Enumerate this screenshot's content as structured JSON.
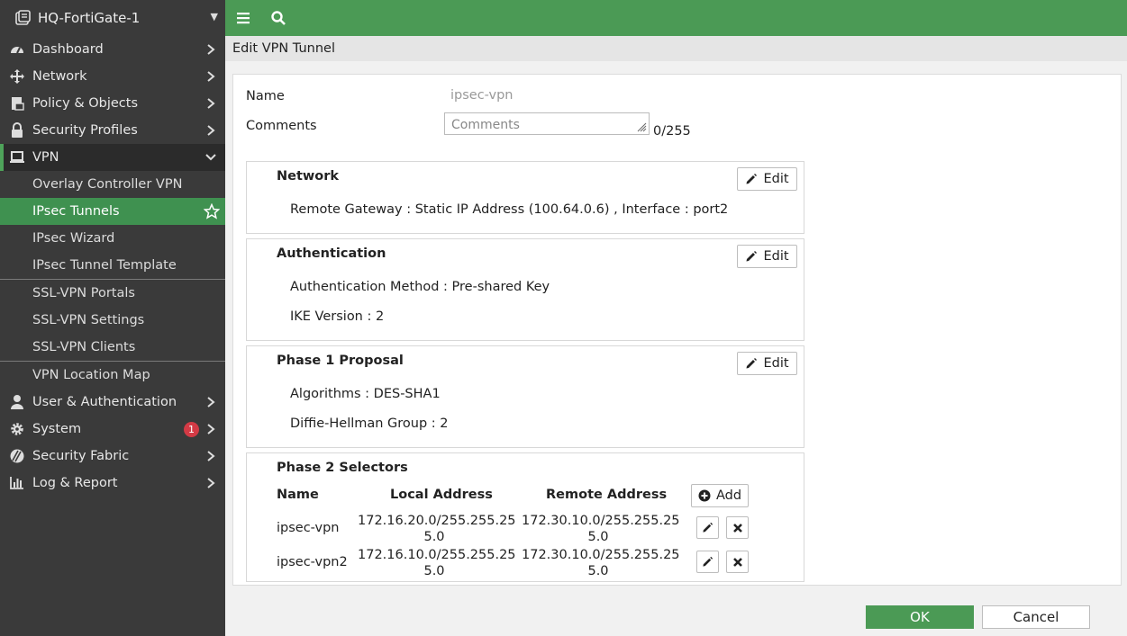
{
  "device": {
    "name": "HQ-FortiGate-1"
  },
  "sidebar": {
    "items": [
      {
        "label": "Dashboard",
        "icon": "dashboard-icon"
      },
      {
        "label": "Network",
        "icon": "network-icon"
      },
      {
        "label": "Policy & Objects",
        "icon": "policy-icon"
      },
      {
        "label": "Security Profiles",
        "icon": "lock-icon"
      },
      {
        "label": "VPN",
        "icon": "laptop-icon"
      }
    ],
    "vpn_sub": [
      "Overlay Controller VPN",
      "IPsec Tunnels",
      "IPsec Wizard",
      "IPsec Tunnel Template",
      "SSL-VPN Portals",
      "SSL-VPN Settings",
      "SSL-VPN Clients",
      "VPN Location Map"
    ],
    "after": [
      {
        "label": "User & Authentication",
        "icon": "user-icon"
      },
      {
        "label": "System",
        "icon": "gear-icon",
        "badge": "1"
      },
      {
        "label": "Security Fabric",
        "icon": "fabric-icon"
      },
      {
        "label": "Log & Report",
        "icon": "chart-icon"
      }
    ]
  },
  "page": {
    "title": "Edit VPN Tunnel"
  },
  "form": {
    "name_label": "Name",
    "name_value": "ipsec-vpn",
    "comments_label": "Comments",
    "comments_placeholder": "Comments",
    "comments_count": "0/255"
  },
  "sections": {
    "network": {
      "title": "Network",
      "edit": "Edit",
      "line1": "Remote Gateway : Static IP Address (100.64.0.6) , Interface : port2"
    },
    "auth": {
      "title": "Authentication",
      "edit": "Edit",
      "line1": "Authentication Method : Pre-shared Key",
      "line2": "IKE Version : 2"
    },
    "phase1": {
      "title": "Phase 1 Proposal",
      "edit": "Edit",
      "line1": "Algorithms : DES-SHA1",
      "line2": "Diffie-Hellman Group : 2"
    },
    "phase2": {
      "title": "Phase 2 Selectors",
      "add": "Add",
      "headers": [
        "Name",
        "Local Address",
        "Remote Address"
      ],
      "rows": [
        {
          "name": "ipsec-vpn",
          "local_a": "172.16.20.0/255.255.25",
          "local_b": "5.0",
          "remote_a": "172.30.10.0/255.255.25",
          "remote_b": "5.0"
        },
        {
          "name": "ipsec-vpn2",
          "local_a": "172.16.10.0/255.255.25",
          "local_b": "5.0",
          "remote_a": "172.30.10.0/255.255.25",
          "remote_b": "5.0"
        }
      ]
    }
  },
  "footer": {
    "ok": "OK",
    "cancel": "Cancel"
  },
  "colors": {
    "accent": "#4b9a55",
    "active": "#3f9150",
    "sidebar": "#3a3a3a",
    "badge": "#d33a45"
  }
}
